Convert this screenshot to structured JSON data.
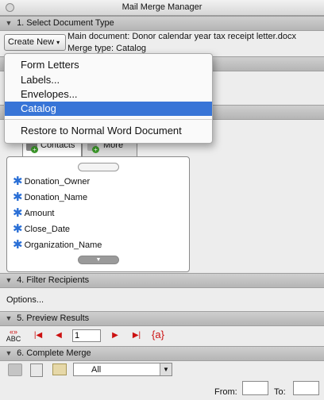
{
  "window": {
    "title": "Mail Merge Manager"
  },
  "section1": {
    "header": "1. Select Document Type",
    "create_new_label": "Create New",
    "main_document": "Main document: Donor calendar year tax receipt letter.docx",
    "merge_type": "Merge type: Catalog"
  },
  "dropdown_menu": {
    "items": [
      "Form Letters",
      "Labels...",
      "Envelopes...",
      "Catalog"
    ],
    "selected": "Catalog",
    "restore": "Restore to Normal Word Document"
  },
  "tabs": {
    "contacts": "Contacts",
    "more": "More"
  },
  "fields": [
    "Donation_Owner",
    "Donation_Name",
    "Amount",
    "Close_Date",
    "Organization_Name"
  ],
  "section4": {
    "header": "4. Filter Recipients",
    "options_label": "Options..."
  },
  "section5": {
    "header": "5. Preview Results",
    "record_value": "1",
    "abc_label": "ABC",
    "field_code_label": "{a}"
  },
  "section6": {
    "header": "6. Complete Merge",
    "select_value": "All",
    "from_label": "From:",
    "to_label": "To:"
  },
  "colors": {
    "accent": "#3875d7",
    "nav_red": "#cc1111",
    "star_blue": "#2a6fd6"
  }
}
